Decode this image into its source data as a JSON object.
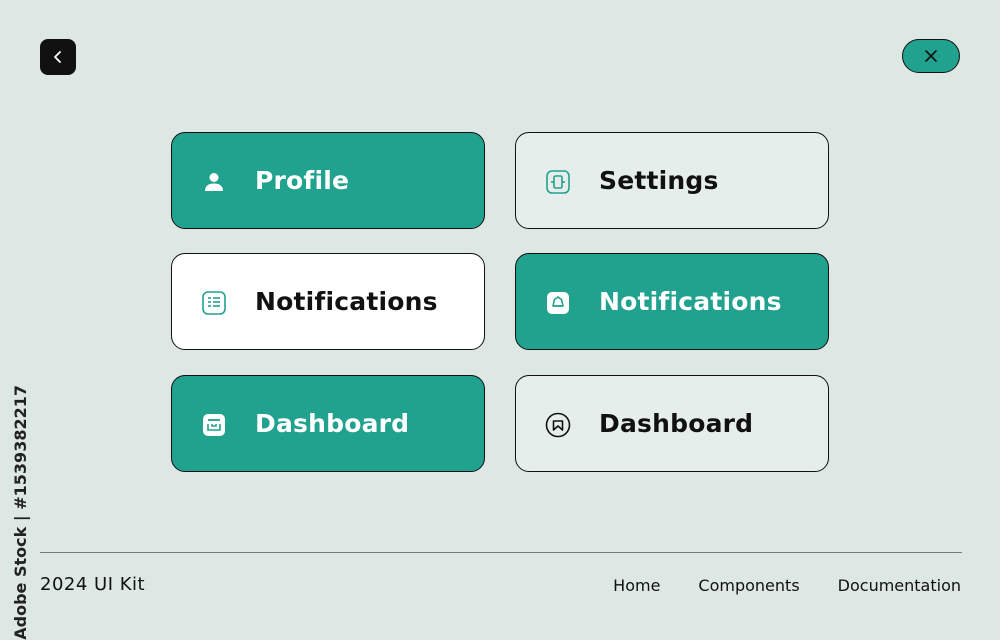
{
  "header": {
    "back_icon": "chevron-left-icon",
    "close_icon": "close-icon"
  },
  "cards": [
    {
      "label": "Profile",
      "icon": "user-icon",
      "style": "filled"
    },
    {
      "label": "Settings",
      "icon": "settings-icon",
      "style": "plain"
    },
    {
      "label": "Notifications",
      "icon": "list-icon",
      "style": "white"
    },
    {
      "label": "Notifications",
      "icon": "bell-icon",
      "style": "filled"
    },
    {
      "label": "Dashboard",
      "icon": "inbox-icon",
      "style": "filled"
    },
    {
      "label": "Dashboard",
      "icon": "badge-icon",
      "style": "plain"
    }
  ],
  "footer": {
    "brand": "2024 UI Kit",
    "nav": [
      "Home",
      "Components",
      "Documentation"
    ]
  },
  "watermark": {
    "stock_id": "Adobe Stock | #1539382217"
  },
  "colors": {
    "accent": "#21a28e",
    "background": "#dde7e3",
    "dark": "#111111",
    "white": "#ffffff"
  }
}
